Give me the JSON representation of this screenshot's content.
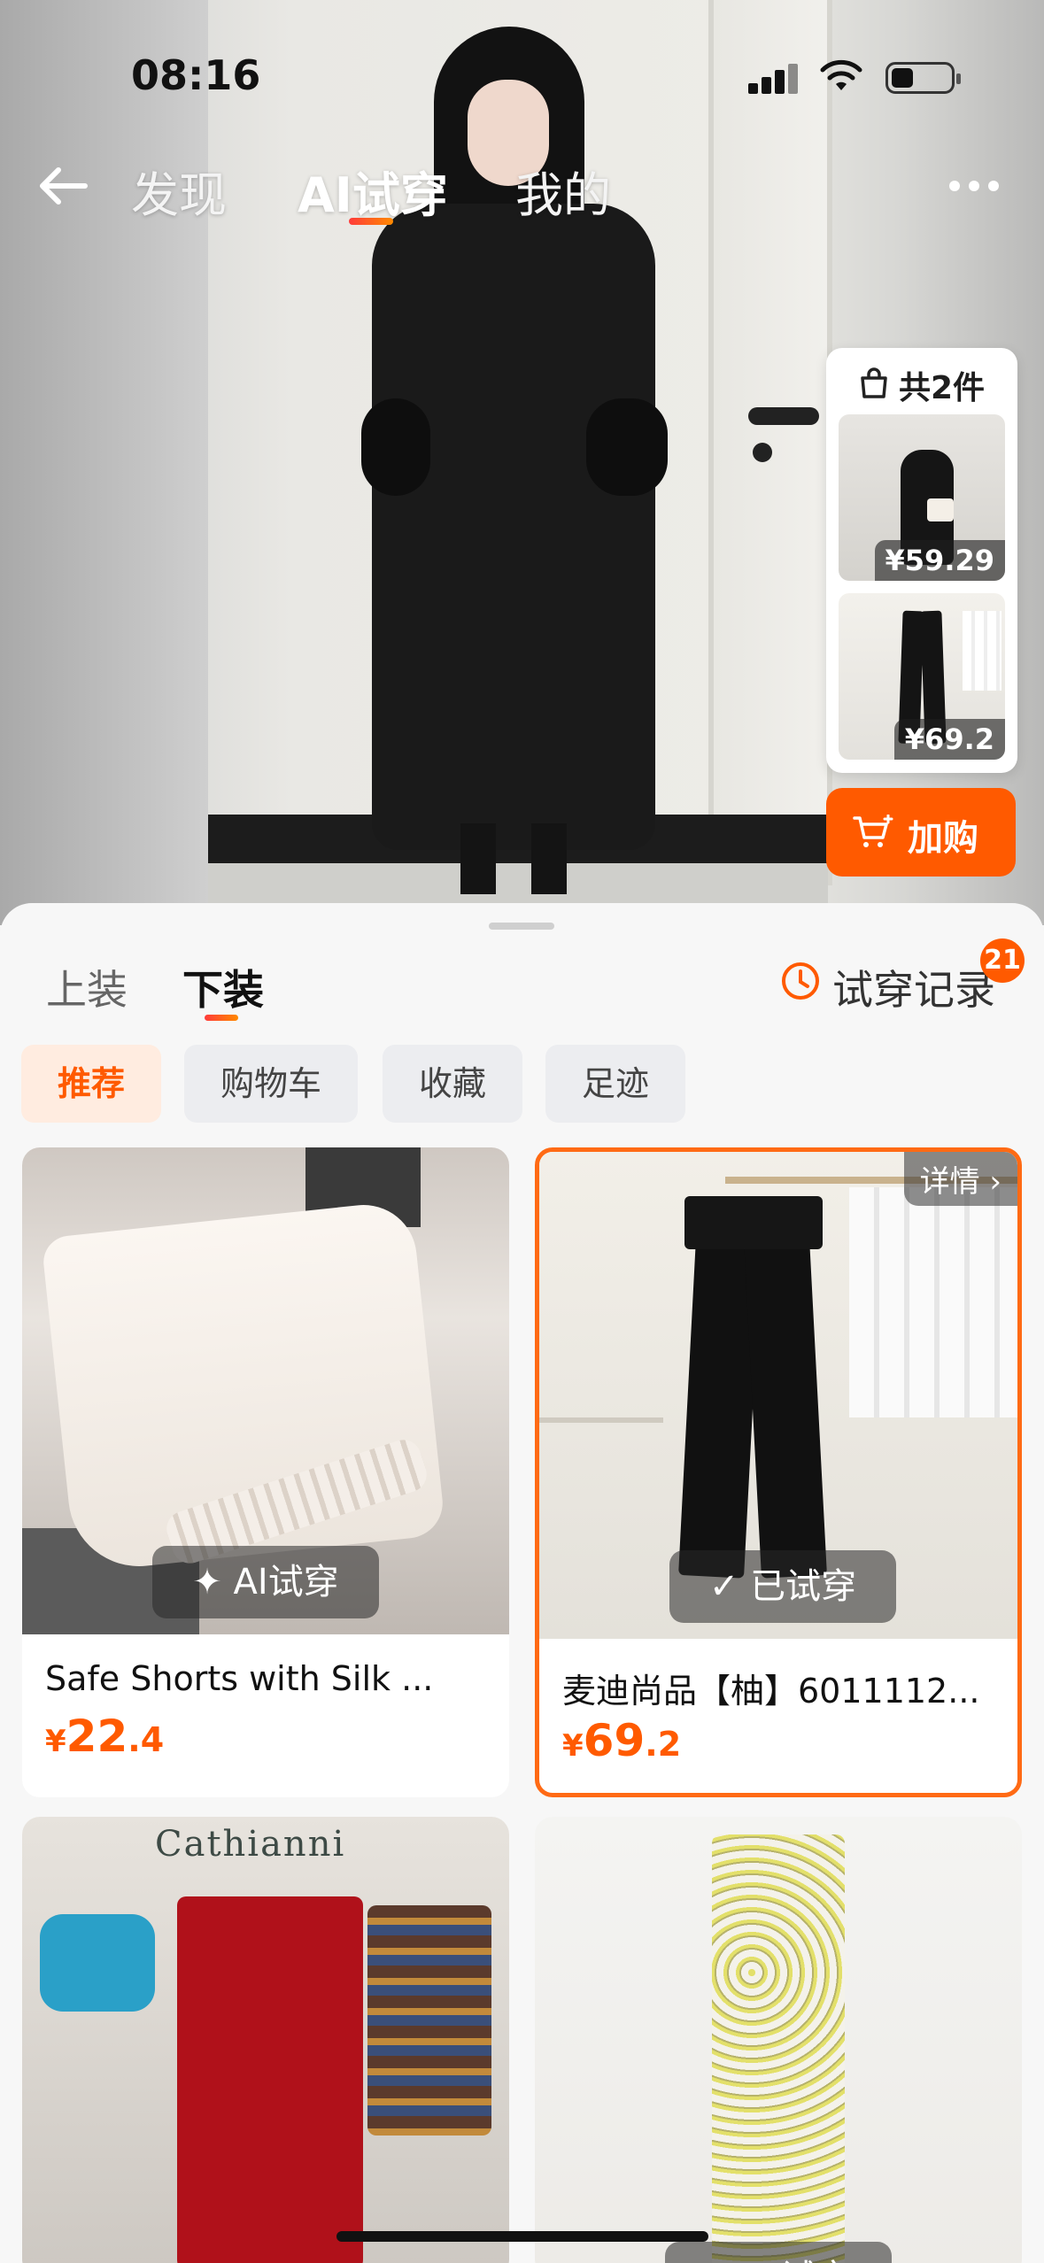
{
  "status_bar": {
    "time": "08:16"
  },
  "nav": {
    "tabs": [
      {
        "label": "发现",
        "active": false
      },
      {
        "label": "AI试穿",
        "active": true
      },
      {
        "label": "我的",
        "active": false
      }
    ]
  },
  "outfit": {
    "title": "共2件",
    "items": [
      {
        "price": "¥59.29"
      },
      {
        "price": "¥69.2"
      }
    ],
    "add_cart_label": "加购"
  },
  "sheet": {
    "segments": [
      {
        "label": "上装",
        "active": false
      },
      {
        "label": "下装",
        "active": true
      }
    ],
    "history_label": "试穿记录",
    "history_badge": "21",
    "chips": [
      {
        "label": "推荐",
        "active": true
      },
      {
        "label": "购物车",
        "active": false
      },
      {
        "label": "收藏",
        "active": false
      },
      {
        "label": "足迹",
        "active": false
      }
    ],
    "products": [
      {
        "title": "Safe Shorts with Silk ...",
        "price_currency": "¥",
        "price_int": "22",
        "price_dec": ".4",
        "action": "✦ AI试穿",
        "selected": false
      },
      {
        "title": "麦迪尚品【柚】6011112...",
        "price_currency": "¥",
        "price_int": "69",
        "price_dec": ".2",
        "action": "✓ 已试穿",
        "detail": "详情 ›",
        "selected": true
      },
      {
        "brand_text": "Cathianni"
      },
      {
        "action": "✦ AI试穿"
      }
    ]
  },
  "colors": {
    "accent": "#ff5a00",
    "selected_border": "#ff6a14"
  }
}
